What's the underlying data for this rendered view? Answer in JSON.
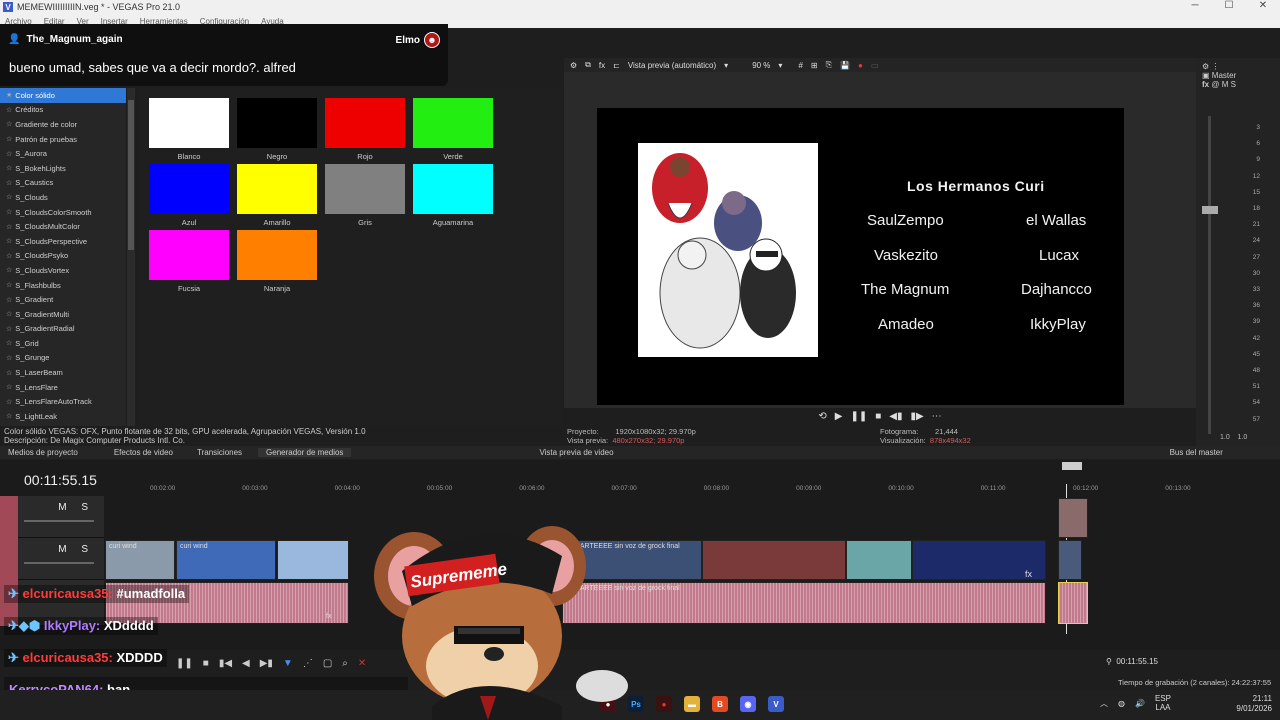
{
  "window": {
    "title": "MEMEWIIIIIIIIIN.veg * - VEGAS Pro 21.0",
    "menu": [
      "Archivo",
      "Editar",
      "Ver",
      "Insertar",
      "Herramientas",
      "Configuración",
      "Ayuda"
    ]
  },
  "chat_top": {
    "user": "The_Magnum_again",
    "badge_user": "Elmo",
    "message": "bueno umad, sabes que va a decir mordo?. alfred"
  },
  "fx_list": [
    {
      "label": "Color sólido",
      "selected": true
    },
    {
      "label": "Créditos"
    },
    {
      "label": "Gradiente de color"
    },
    {
      "label": "Patrón de pruebas"
    },
    {
      "label": "S_Aurora"
    },
    {
      "label": "S_BokehLights"
    },
    {
      "label": "S_Caustics"
    },
    {
      "label": "S_Clouds"
    },
    {
      "label": "S_CloudsColorSmooth"
    },
    {
      "label": "S_CloudsMultColor"
    },
    {
      "label": "S_CloudsPerspective"
    },
    {
      "label": "S_CloudsPsyko"
    },
    {
      "label": "S_CloudsVortex"
    },
    {
      "label": "S_Flashbulbs"
    },
    {
      "label": "S_Gradient"
    },
    {
      "label": "S_GradientMulti"
    },
    {
      "label": "S_GradientRadial"
    },
    {
      "label": "S_Grid"
    },
    {
      "label": "S_Grunge"
    },
    {
      "label": "S_LaserBeam"
    },
    {
      "label": "S_LensFlare"
    },
    {
      "label": "S_LensFlareAutoTrack"
    },
    {
      "label": "S_LightLeak"
    }
  ],
  "swatches": [
    {
      "label": "Blanco",
      "color": "#ffffff"
    },
    {
      "label": "Negro",
      "color": "#000000"
    },
    {
      "label": "Rojo",
      "color": "#ee0000"
    },
    {
      "label": "Verde",
      "color": "#22ee11"
    },
    {
      "label": "Azul",
      "color": "#0000ff"
    },
    {
      "label": "Amarillo",
      "color": "#ffff00"
    },
    {
      "label": "Gris",
      "color": "#808080"
    },
    {
      "label": "Aguamarina",
      "color": "#00ffff"
    },
    {
      "label": "Fucsia",
      "color": "#ff00ff"
    },
    {
      "label": "Naranja",
      "color": "#ff8000"
    }
  ],
  "description": {
    "line1": "Color sólido VEGAS: OFX, Punto flotante de 32 bits, GPU acelerada, Agrupación VEGAS, Versión 1.0",
    "line2": "Descripción: De Magix Computer Products Intl. Co."
  },
  "tabs": [
    "Medios de proyecto",
    "Efectos de video",
    "Transiciones",
    "Generador de medios",
    "Vista previa de video",
    "Bus del master"
  ],
  "preview": {
    "mode": "Vista previa (automático)",
    "zoom": "90 %",
    "video_title": "Los Hermanos Curi",
    "names_left": [
      "SaulZempo",
      "Vaskezito",
      "The Magnum",
      "Amadeo"
    ],
    "names_right": [
      "el Wallas",
      "Lucax",
      "Dajhancco",
      "IkkyPlay"
    ],
    "proyecto_label": "Proyecto:",
    "proyecto_value": "1920x1080x32; 29.970p",
    "vista_label": "Vista previa:",
    "vista_value": "480x270x32; 29.970p",
    "fotograma_label": "Fotograma:",
    "fotograma_value": "21,444",
    "visualizacion_label": "Visualización:",
    "visualizacion_value": "878x494x32"
  },
  "master": {
    "label": "Master",
    "scale": [
      "3",
      "6",
      "9",
      "12",
      "15",
      "18",
      "21",
      "24",
      "27",
      "30",
      "33",
      "36",
      "39",
      "42",
      "45",
      "48",
      "51",
      "54",
      "57"
    ],
    "values": [
      "1.0",
      "1.0"
    ]
  },
  "timeline": {
    "timecode": "00:11:55.15",
    "ruler": [
      "00:02:00",
      "00:03:00",
      "00:04:00",
      "00:05:00",
      "00:06:00",
      "00:07:00",
      "00:08:00",
      "00:09:00",
      "00:10:00",
      "00:11:00",
      "00:12:00",
      "00:13:00"
    ],
    "track_ms": "M S",
    "clip_labels": {
      "curi_wind": "curi wind",
      "parte": "MI PARTEEEE sin voz de grock final",
      "audio_parte": "MI PARTEEEE sin voz de grock final",
      "fx": "fx"
    },
    "cursor_time": "00:11:55.15",
    "recording": "Tiempo de grabación (2 canales): 24:22:37:55"
  },
  "chat_lines": [
    {
      "name": "elcuricausa35:",
      "text": " #umadfolla"
    },
    {
      "name": "IkkyPlay:",
      "text": " XDdddd"
    },
    {
      "name": "elcuricausa35:",
      "text": " XDDDD"
    }
  ],
  "chat_last": {
    "name": "KerrycoPAN64:",
    "text": " ban"
  },
  "overlay": {
    "cap_text": "Suprememe"
  },
  "taskbar": {
    "lang1": "ESP",
    "lang2": "LAA",
    "time": "21:11",
    "date": "9/01/2026"
  }
}
